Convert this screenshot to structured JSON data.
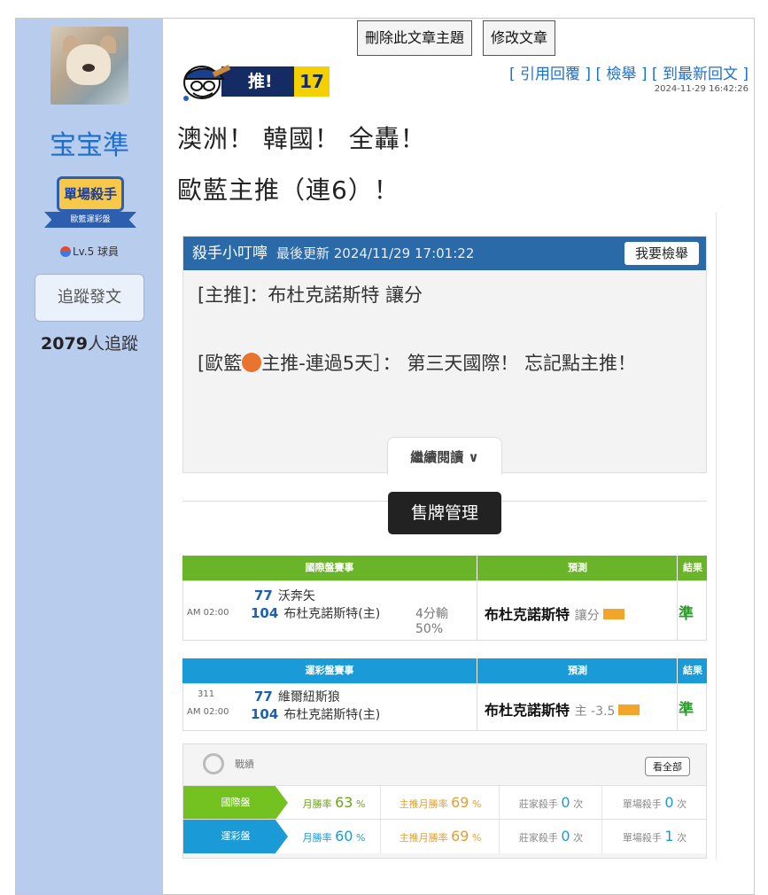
{
  "sidebar": {
    "username": "宝宝準",
    "badge_title": "單場殺手",
    "badge_ribbon": "歐籃運彩盤",
    "level": "Lv.5 球員",
    "follow_button": "追蹤發文",
    "followers_count": "2079",
    "followers_label": "人追蹤"
  },
  "admin": {
    "delete_topic": "刪除此文章主題",
    "edit_post": "修改文章"
  },
  "post": {
    "push_label": "推!",
    "push_count": "17",
    "actions": [
      "[ 引用回覆 ]",
      "[ 檢舉 ]",
      "[ 到最新回文 ]"
    ],
    "timestamp": "2024-11-29 16:42:26",
    "line1": "澳洲！ 韓國！ 全轟！",
    "line2": "歐藍主推（連6）！"
  },
  "embed": {
    "header_title": "殺手小叮嚀",
    "header_sub": "最後更新 2024/11/29 17:01:22",
    "report_button": "我要檢舉",
    "p1": "[主推]：布杜克諾斯特 讓分",
    "p2_a": "[歐籃",
    "p2_b": "主推-連過5天］： 第三天國際！ 忘記點主推！",
    "read_more": "繼續閱讀 ∨",
    "sell_button": "售牌管理"
  },
  "table_intl": {
    "color": "#6ab42a",
    "headers": [
      "國際盤賽事",
      "預測",
      "結果"
    ],
    "time": "AM 02:00",
    "team1_num": "77",
    "team1": "沃奔矢",
    "team2_num": "104",
    "team2": "布杜克諾斯特(主)",
    "note1": "4分輸",
    "note2": "50%",
    "pred_team": "布杜克諾斯特",
    "pred_type": "讓分",
    "result": "準"
  },
  "table_lottery": {
    "color": "#1a9ad6",
    "headers": [
      "運彩盤賽事",
      "預測",
      "結果"
    ],
    "game_no": "311",
    "time": "AM 02:00",
    "team1_num": "77",
    "team1": "維爾紐斯狼",
    "team2_num": "104",
    "team2": "布杜克諾斯特(主)",
    "pred_team": "布杜克諾斯特",
    "pred_type": "主 -3.5",
    "result": "準"
  },
  "stats": {
    "title": "戰績",
    "view_all": "看全部",
    "rows": [
      {
        "tag": "國際盤",
        "tag_color": "#74c21f",
        "m_label": "月勝率",
        "m_val": "63",
        "mp_label": "主推月勝率",
        "mp_val": "69",
        "banker_label": "莊家殺手",
        "banker_val": "0",
        "single_label": "單場殺手",
        "single_val": "0",
        "unit": "次"
      },
      {
        "tag": "運彩盤",
        "tag_color": "#1a9ad6",
        "m_label": "月勝率",
        "m_val": "60",
        "mp_label": "主推月勝率",
        "mp_val": "69",
        "banker_label": "莊家殺手",
        "banker_val": "0",
        "single_label": "單場殺手",
        "single_val": "1",
        "unit": "次"
      }
    ]
  },
  "colors": {
    "sidebar_bg": "#b8ccee",
    "link_blue": "#1f6fc9",
    "header_blue": "#2b6aa8",
    "push_navy": "#152b63",
    "push_yellow": "#f5d000"
  }
}
